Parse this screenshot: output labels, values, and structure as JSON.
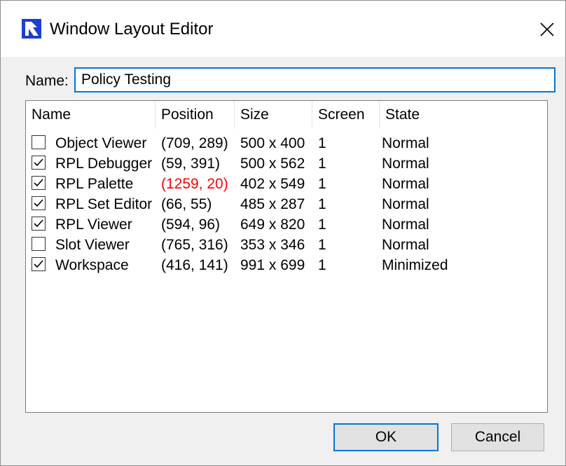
{
  "window": {
    "title": "Window Layout Editor",
    "close_glyph": "✕"
  },
  "name_field": {
    "label": "Name:",
    "value": "Policy Testing"
  },
  "table": {
    "headers": [
      "Name",
      "Position",
      "Size",
      "Screen",
      "State"
    ],
    "rows": [
      {
        "checked": false,
        "name": "Object Viewer",
        "position": "(709, 289)",
        "position_warning": false,
        "size": "500 x 400",
        "screen": "1",
        "state": "Normal"
      },
      {
        "checked": true,
        "name": "RPL Debugger",
        "position": "(59, 391)",
        "position_warning": false,
        "size": "500 x 562",
        "screen": "1",
        "state": "Normal"
      },
      {
        "checked": true,
        "name": "RPL Palette",
        "position": "(1259, 20)",
        "position_warning": true,
        "size": "402 x 549",
        "screen": "1",
        "state": "Normal"
      },
      {
        "checked": true,
        "name": "RPL Set Editor",
        "position": "(66, 55)",
        "position_warning": false,
        "size": "485 x 287",
        "screen": "1",
        "state": "Normal"
      },
      {
        "checked": true,
        "name": "RPL Viewer",
        "position": "(594, 96)",
        "position_warning": false,
        "size": "649 x 820",
        "screen": "1",
        "state": "Normal"
      },
      {
        "checked": false,
        "name": "Slot Viewer",
        "position": "(765, 316)",
        "position_warning": false,
        "size": "353 x 346",
        "screen": "1",
        "state": "Normal"
      },
      {
        "checked": true,
        "name": "Workspace",
        "position": "(416, 141)",
        "position_warning": false,
        "size": "991 x 699",
        "screen": "1",
        "state": "Minimized"
      }
    ]
  },
  "buttons": {
    "ok": "OK",
    "cancel": "Cancel"
  },
  "colors": {
    "accent": "#0078d7",
    "warning_text": "#ff0000",
    "icon_blue": "#1d3fd1"
  },
  "icons": {
    "app": "riverware-logo-icon",
    "close": "close-icon",
    "check": "checkmark-icon"
  }
}
